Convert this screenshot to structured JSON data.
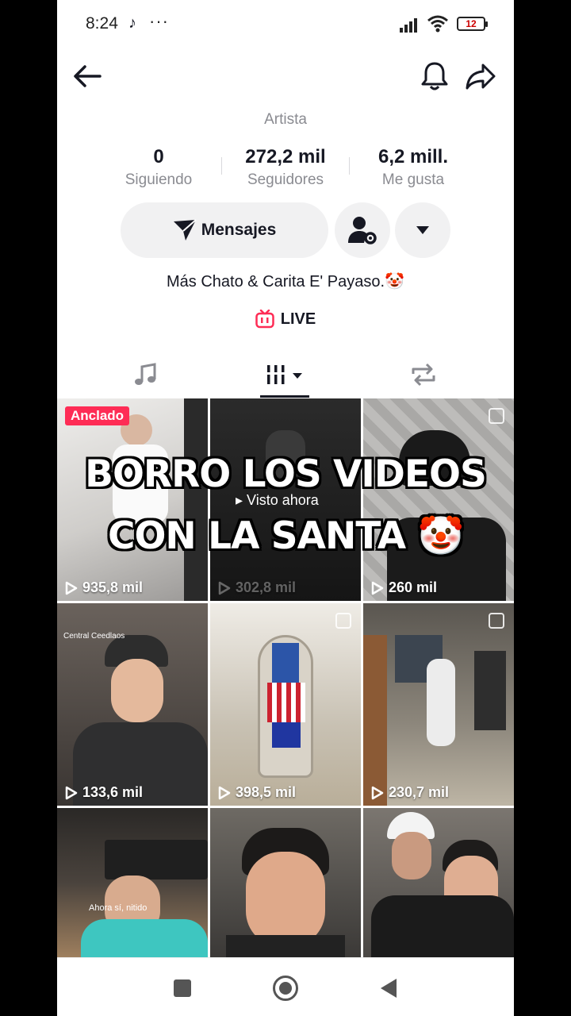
{
  "status_bar": {
    "time": "8:24",
    "app_glyph": "♪",
    "dots": "···",
    "battery": "12"
  },
  "header": {
    "icons": [
      "back-arrow-icon",
      "bell-icon",
      "share-icon"
    ]
  },
  "profile": {
    "category": "Artista",
    "stats": [
      {
        "value": "0",
        "label": "Siguiendo"
      },
      {
        "value": "272,2 mil",
        "label": "Seguidores"
      },
      {
        "value": "6,2 mill.",
        "label": "Me gusta"
      }
    ],
    "message_button": "Mensajes",
    "bio": "Más Chato & Carita E' Payaso.🤡",
    "live_label": "LIVE"
  },
  "tabs": [
    "music-icon",
    "videos-grid-icon",
    "repost-icon"
  ],
  "overlay": {
    "line1": "BORRO LOS VIDEOS",
    "line2": "CON LA SANTA 🤡"
  },
  "videos": [
    {
      "views": "935,8 mil",
      "badge": "Anclado",
      "bg": "#d7d5d2"
    },
    {
      "views": "302,8 mil",
      "seen": "Visto ahora",
      "bg": "#1f1f1f"
    },
    {
      "views": "260 mil",
      "bg": "#8e8d8b"
    },
    {
      "views": "133,6 mil",
      "caption_top": "Central Ceedlaos",
      "bg": "#4a4541"
    },
    {
      "views": "398,5 mil",
      "bg": "#c9c3b8"
    },
    {
      "views": "230,7 mil",
      "bg": "#6f6b63"
    },
    {
      "views": "",
      "caption": "Ahora sí, nitido",
      "bg": "#3a3633"
    },
    {
      "views": "",
      "bg": "#5a5550"
    },
    {
      "views": "",
      "bg": "#54504c"
    }
  ],
  "navbar": [
    "recents-square-icon",
    "home-circle-icon",
    "back-triangle-icon"
  ]
}
